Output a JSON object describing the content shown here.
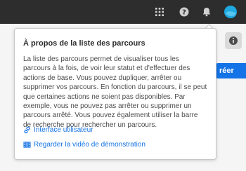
{
  "popover": {
    "title": "À propos de la liste des parcours",
    "body": "La liste des parcours permet de visualiser tous les parcours à la fois, de voir leur statut et d'effectuer des actions de base. Vous pouvez dupliquer, arrêter ou supprimer vos parcours. En fonction du parcours, il se peut que certaines actions ne soient pas disponibles. Par exemple, vous ne pouvez pas arrêter ou supprimer un parcours arrêté. Vous pouvez également utiliser la barre de recherche pour rechercher un parcours.",
    "links": [
      {
        "label": "Interface utilisateur",
        "icon": "link-icon"
      },
      {
        "label": "Regarder la vidéo de démonstration",
        "icon": "video-icon"
      }
    ]
  },
  "main": {
    "create_button_label": "réer"
  },
  "colors": {
    "topbar": "#2d2d2d",
    "accent": "#1473e6",
    "avatar": "#1fa9e1"
  }
}
